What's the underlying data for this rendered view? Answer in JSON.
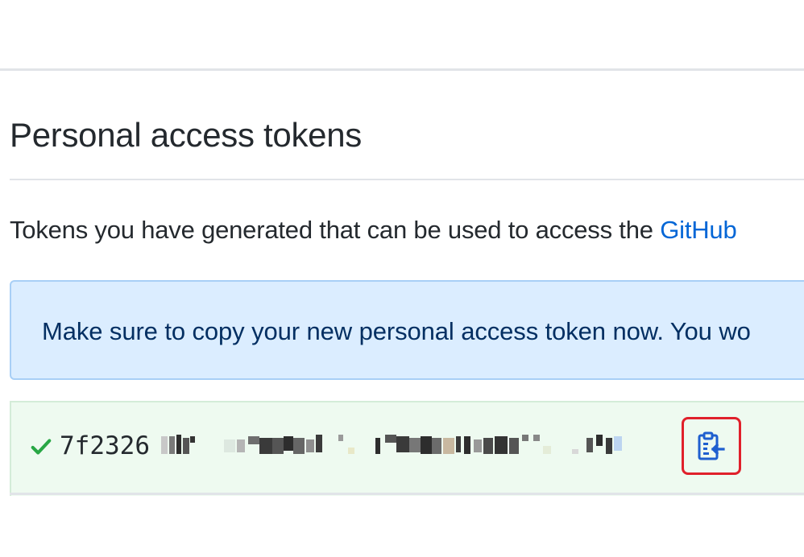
{
  "section": {
    "title": "Personal access tokens"
  },
  "description": {
    "text": "Tokens you have generated that can be used to access the ",
    "link_text": "GitHub"
  },
  "flash": {
    "message": "Make sure to copy your new personal access token now. You wo"
  },
  "token": {
    "visible_prefix": "7f2326",
    "status_icon": "check-icon",
    "copy_icon": "clippy-icon"
  },
  "colors": {
    "link": "#0366d6",
    "flash_bg": "#dbedff",
    "token_bg": "#eefaf0",
    "check": "#28a745",
    "highlight": "#e0202b"
  }
}
